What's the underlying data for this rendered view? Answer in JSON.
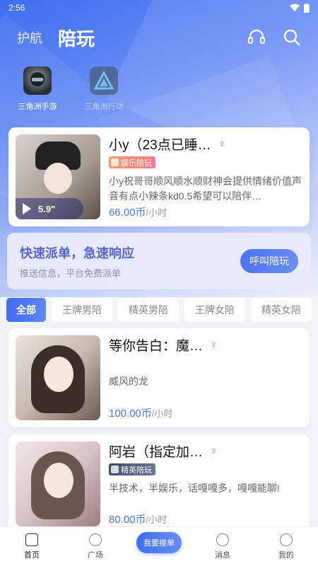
{
  "status": {
    "time": "2:56"
  },
  "nav": {
    "tabs": [
      "护航",
      "陪玩"
    ]
  },
  "games": [
    {
      "label": "三角洲手游"
    },
    {
      "label": "三角洲行动"
    }
  ],
  "featured": {
    "name": "小y（23点已睡…",
    "gender": "♀",
    "tag": "娱乐陪玩",
    "voice": "5.9\"",
    "desc": "小y祝哥哥顺风顺水顺财神会提供情绪价值声音有点小辣条kd0.5希望可以陪伴…",
    "price": "66.00币",
    "unit": "/小时"
  },
  "quick": {
    "title": "快速派单，急速响应",
    "subtitle": "推送信息，平台免费派单",
    "button": "呼叫陪玩"
  },
  "filters": [
    "全部",
    "王牌男陪",
    "精英男陪",
    "王牌女陪",
    "精英女陪"
  ],
  "players": [
    {
      "name": "等你告白：魔…",
      "gender": "♀",
      "desc": "威风的龙",
      "price": "100.00币",
      "unit": "/小时"
    },
    {
      "name": "阿岩（指定加…",
      "gender": "♀",
      "tag": "精英陪玩",
      "desc": "半技术，半娱乐，话嘎嘎多，嘎嘎能聊!",
      "price": "80.00币",
      "unit": "/小时"
    }
  ],
  "bottom_nav": [
    "首页",
    "广场",
    "我要接单",
    "消息",
    "我的"
  ],
  "colors": {
    "accent": "#3f6df0",
    "price": "#4a74f0",
    "female": "#f06292"
  }
}
